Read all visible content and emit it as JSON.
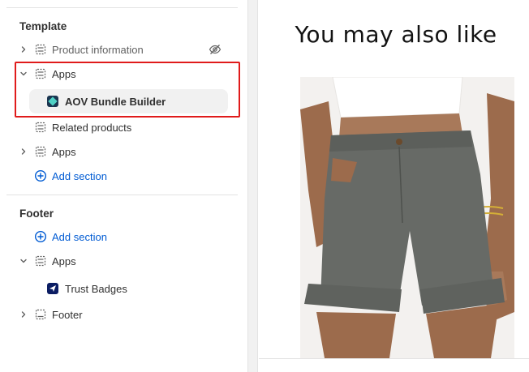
{
  "sidebar": {
    "template_title": "Template",
    "footer_title": "Footer",
    "template_items": [
      {
        "label": "Product information",
        "icon": "section-icon",
        "hidden_icon": "eye-slash-icon"
      },
      {
        "label": "Apps",
        "icon": "section-icon",
        "expanded": true
      },
      {
        "label": "AOV Bundle Builder",
        "icon": "aov-bundle-builder-logo"
      },
      {
        "label": "Related products",
        "icon": "section-icon"
      },
      {
        "label": "Apps",
        "icon": "section-icon"
      },
      {
        "label": "Add section",
        "icon": "plus-circle-icon"
      }
    ],
    "footer_items": [
      {
        "label": "Add section",
        "icon": "plus-circle-icon"
      },
      {
        "label": "Apps",
        "icon": "section-icon",
        "expanded": true
      },
      {
        "label": "Trust Badges",
        "icon": "trust-badges-logo"
      },
      {
        "label": "Footer",
        "icon": "footer-section-icon"
      }
    ]
  },
  "preview": {
    "heading": "You may also like",
    "image": "gray-corduroy-shorts-product-photo"
  },
  "colors": {
    "link": "#005bd3",
    "highlight": "#e01b1b",
    "selected_bg": "#f1f1f1",
    "text": "#303030"
  }
}
